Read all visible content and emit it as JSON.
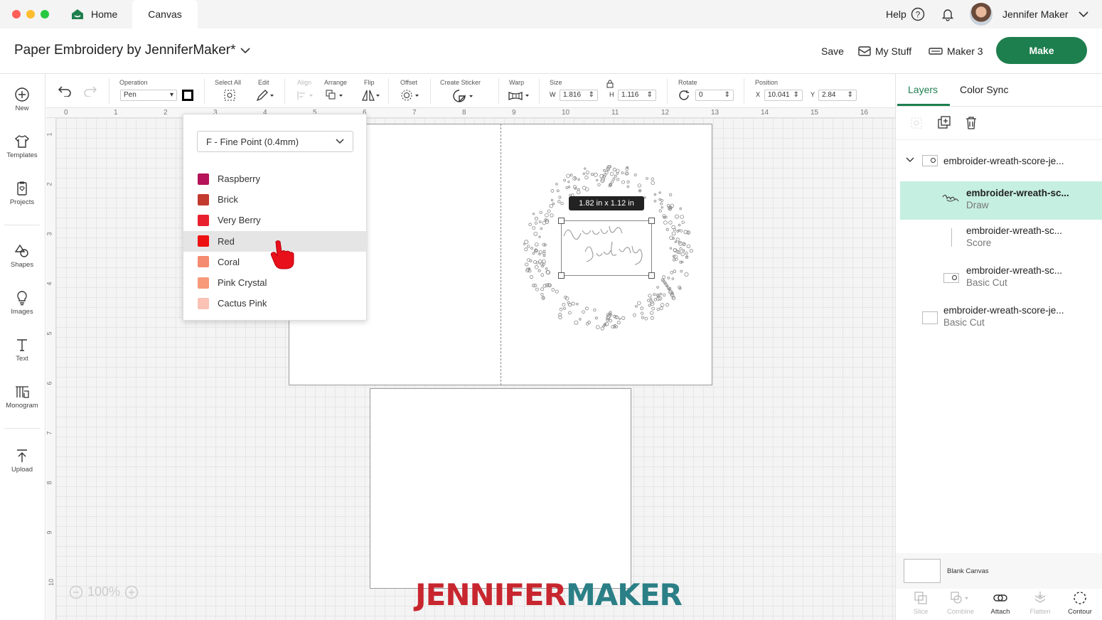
{
  "titlebar": {
    "tabs": [
      {
        "label": "Home"
      },
      {
        "label": "Canvas"
      }
    ],
    "help_label": "Help",
    "user_name": "Jennifer Maker"
  },
  "header": {
    "project_title": "Paper Embroidery by JenniferMaker*",
    "save_label": "Save",
    "mystuff_label": "My Stuff",
    "machine_label": "Maker 3",
    "make_label": "Make"
  },
  "sidebar": {
    "items": [
      {
        "label": "New",
        "icon": "plus-circle-icon"
      },
      {
        "label": "Templates",
        "icon": "shirt-icon"
      },
      {
        "label": "Projects",
        "icon": "clipboard-icon"
      },
      {
        "label": "Shapes",
        "icon": "shapes-icon"
      },
      {
        "label": "Images",
        "icon": "lightbulb-icon"
      },
      {
        "label": "Text",
        "icon": "text-icon"
      },
      {
        "label": "Monogram",
        "icon": "monogram-icon"
      },
      {
        "label": "Upload",
        "icon": "upload-icon"
      }
    ]
  },
  "toolbar": {
    "operation_label": "Operation",
    "operation_value": "Pen",
    "select_all_label": "Select All",
    "edit_label": "Edit",
    "align_label": "Align",
    "arrange_label": "Arrange",
    "flip_label": "Flip",
    "offset_label": "Offset",
    "create_sticker_label": "Create Sticker",
    "warp_label": "Warp",
    "size_label": "Size",
    "w_label": "W",
    "w_value": "1.816",
    "h_label": "H",
    "h_value": "1.116",
    "rotate_label": "Rotate",
    "rotate_value": "0",
    "position_label": "Position",
    "x_label": "X",
    "x_value": "10.041",
    "y_label": "Y",
    "y_value": "2.84"
  },
  "rulers": {
    "top": [
      "0",
      "1",
      "2",
      "3",
      "4",
      "5",
      "6",
      "7",
      "8",
      "9",
      "10",
      "11",
      "12",
      "13",
      "14",
      "15",
      "16"
    ],
    "left": [
      "1",
      "2",
      "3",
      "4",
      "5",
      "6",
      "7",
      "8",
      "9",
      "10"
    ]
  },
  "canvas": {
    "size_tooltip": "1.82  in x 1.12  in",
    "zoom_label": "100%",
    "brand_left": "JENNIFER",
    "brand_right": "MAKER",
    "brand_colors": {
      "left": "#c8262f",
      "right": "#2b7f86"
    }
  },
  "pen_dropdown": {
    "selected_pen": "F - Fine Point (0.4mm)",
    "colors": [
      {
        "name": "Raspberry",
        "hex": "#b5135a"
      },
      {
        "name": "Brick",
        "hex": "#c23a30"
      },
      {
        "name": "Very Berry",
        "hex": "#e8202e"
      },
      {
        "name": "Red",
        "hex": "#ee1111"
      },
      {
        "name": "Coral",
        "hex": "#f58b70"
      },
      {
        "name": "Pink Crystal",
        "hex": "#f79a7a"
      },
      {
        "name": "Cactus Pink",
        "hex": "#f9c2b5"
      }
    ],
    "highlighted": "Red"
  },
  "right_panel": {
    "tabs": [
      {
        "label": "Layers"
      },
      {
        "label": "Color Sync"
      }
    ],
    "layers": [
      {
        "name": "embroider-wreath-score-je...",
        "operation": ""
      },
      {
        "name": "embroider-wreath-sc...",
        "operation": "Draw"
      },
      {
        "name": "embroider-wreath-sc...",
        "operation": "Score"
      },
      {
        "name": "embroider-wreath-sc...",
        "operation": "Basic Cut"
      },
      {
        "name": "embroider-wreath-score-je...",
        "operation": "Basic Cut"
      }
    ],
    "blank_canvas_label": "Blank Canvas",
    "bottom_tools": [
      {
        "label": "Slice"
      },
      {
        "label": "Combine"
      },
      {
        "label": "Attach"
      },
      {
        "label": "Flatten"
      },
      {
        "label": "Contour"
      }
    ]
  }
}
